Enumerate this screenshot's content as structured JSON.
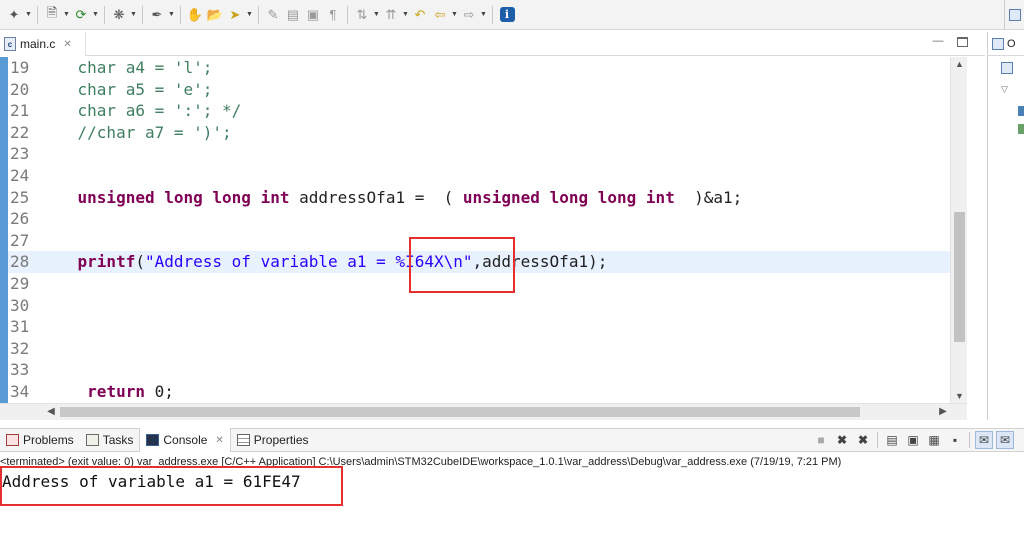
{
  "toolbar": {
    "buttons": [
      "new-icon",
      "new-c-file-icon",
      "refresh-icon",
      "debug-icon",
      "build-icon",
      "hand-icon",
      "open-folder-icon",
      "run-icon",
      "edit-icon",
      "format-icon",
      "paragraph-icon",
      "navigate-icon",
      "back-arrow-icon",
      "forward-arrow-icon",
      "info-icon"
    ]
  },
  "editor": {
    "tab_label": "main.c",
    "lines": [
      {
        "n": "19",
        "text": "    char a4 = 'l';"
      },
      {
        "n": "20",
        "text": "    char a5 = 'e';"
      },
      {
        "n": "21",
        "text": "    char a6 = ':'; */"
      },
      {
        "n": "22",
        "text": "    //char a7 = ')';"
      },
      {
        "n": "23",
        "text": ""
      },
      {
        "n": "24",
        "text": ""
      },
      {
        "n": "25",
        "text": "    unsigned long long int addressOfa1 =  ( unsigned long long int  )&a1;"
      },
      {
        "n": "26",
        "text": ""
      },
      {
        "n": "27",
        "text": ""
      },
      {
        "n": "28",
        "text": "    printf(\"Address of variable a1 = %I64X\\n\",addressOfa1);"
      },
      {
        "n": "29",
        "text": ""
      },
      {
        "n": "30",
        "text": ""
      },
      {
        "n": "31",
        "text": ""
      },
      {
        "n": "32",
        "text": ""
      },
      {
        "n": "33",
        "text": ""
      },
      {
        "n": "34",
        "text": "     return 0;"
      }
    ],
    "current_line": "28"
  },
  "side_panel": {
    "tab_label": "O"
  },
  "console": {
    "tabs": [
      {
        "label": "Problems",
        "icon": "problems-icon"
      },
      {
        "label": "Tasks",
        "icon": "tasks-icon"
      },
      {
        "label": "Console",
        "icon": "console-icon",
        "active": true
      },
      {
        "label": "Properties",
        "icon": "properties-icon"
      }
    ],
    "terminated_line": "<terminated> (exit value: 0) var_address.exe [C/C++ Application] C:\\Users\\admin\\STM32CubeIDE\\workspace_1.0.1\\var_address\\Debug\\var_address.exe (7/19/19, 7:21 PM)",
    "output": "Address of variable a1 = 61FE47"
  },
  "colors": {
    "keyword": "#7f0055",
    "comment": "#3f7f5f",
    "string": "#2a00ff",
    "highlight_box": "#e53030",
    "current_line_bg": "#e8f2fe",
    "ruler": "#5b9bd5"
  }
}
